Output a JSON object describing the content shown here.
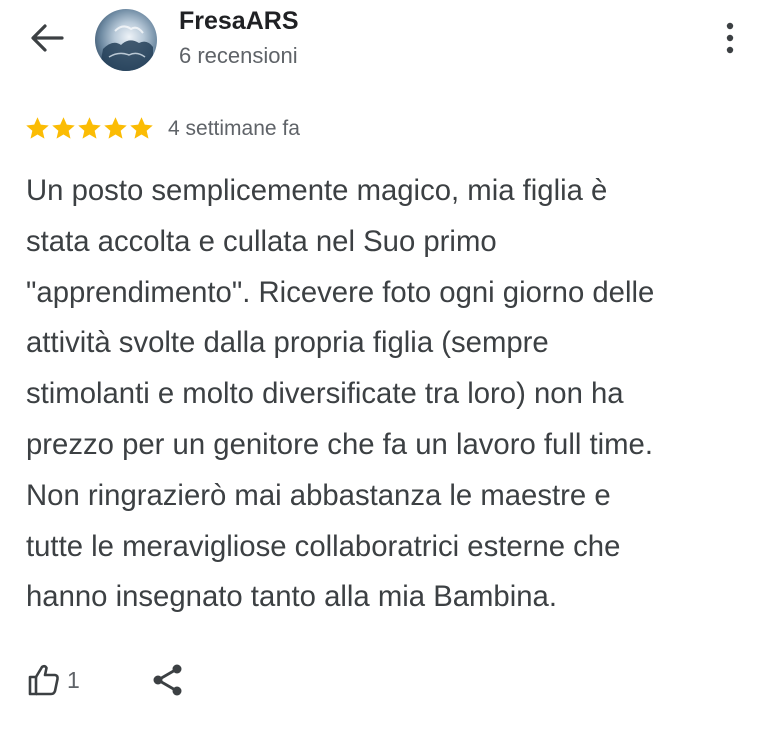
{
  "header": {
    "back_icon": "arrow-back-icon",
    "author_name": "FresaARS",
    "review_count": "6 recensioni",
    "more_icon": "more-vert-icon"
  },
  "rating": {
    "stars": 5,
    "max_stars": 5,
    "star_color": "#fbbc04",
    "date": "4 settimane fa"
  },
  "review": {
    "lines": [
      "Un posto semplicemente magico, mia figlia è",
      "stata accolta e cullata nel Suo primo",
      "\"apprendimento\". Ricevere foto ogni giorno delle",
      "attività svolte dalla propria figlia (sempre",
      "stimolanti e molto diversificate tra loro) non ha",
      "prezzo per un genitore che fa un lavoro full time.",
      "Non ringrazierò mai abbastanza le maestre e",
      "tutte le meravigliose collaboratrici esterne che",
      "hanno insegnato tanto alla mia Bambina."
    ]
  },
  "actions": {
    "like_icon": "thumb-up-icon",
    "like_count": "1",
    "share_icon": "share-icon"
  }
}
